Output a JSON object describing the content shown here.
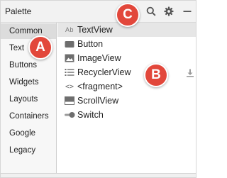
{
  "panel": {
    "title": "Palette"
  },
  "header_icons": [
    "search-icon",
    "gear-icon",
    "minimize-icon"
  ],
  "categories": [
    {
      "label": "Common",
      "selected": true
    },
    {
      "label": "Text",
      "selected": false
    },
    {
      "label": "Buttons",
      "selected": false
    },
    {
      "label": "Widgets",
      "selected": false
    },
    {
      "label": "Layouts",
      "selected": false
    },
    {
      "label": "Containers",
      "selected": false
    },
    {
      "label": "Google",
      "selected": false
    },
    {
      "label": "Legacy",
      "selected": false
    }
  ],
  "items": [
    {
      "label": "TextView",
      "icon": "text-ab-icon",
      "icon_text": "Ab",
      "selected": true
    },
    {
      "label": "Button",
      "icon": "button-icon"
    },
    {
      "label": "ImageView",
      "icon": "image-icon"
    },
    {
      "label": "RecyclerView",
      "icon": "list-icon"
    },
    {
      "label": "<fragment>",
      "icon": "fragment-tag-icon",
      "icon_text": "<>"
    },
    {
      "label": "ScrollView",
      "icon": "scrollview-icon"
    },
    {
      "label": "Switch",
      "icon": "switch-icon"
    }
  ],
  "callouts": {
    "a": "A",
    "b": "B",
    "c": "C"
  },
  "colors": {
    "callout": "#e2473b",
    "selected_category": "#dcdcdc",
    "selected_item": "#e6e6e6",
    "icon": "#6e6e6e"
  }
}
